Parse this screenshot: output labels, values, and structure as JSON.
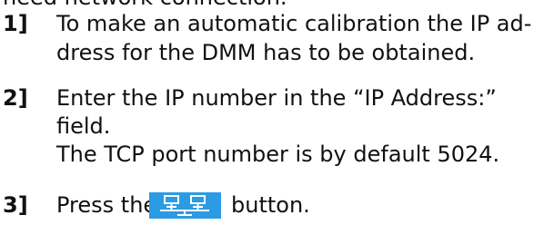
{
  "document": {
    "partial_top_line": "need network connection.",
    "steps": [
      {
        "number": "1]",
        "lines": [
          "To make an automatic calibration the IP ad-",
          "dress for the DMM has to be obtained."
        ]
      },
      {
        "number": "2]",
        "lines": [
          "Enter the IP number in the “IP Address:”",
          "field.",
          "The TCP port number is by default 5024."
        ]
      },
      {
        "number": "3]",
        "before_button": "Press the",
        "after_button": "button.",
        "button_icon": "network-icon"
      }
    ]
  },
  "colors": {
    "button_bg": "#2b9be4",
    "icon": "#ffffff"
  }
}
